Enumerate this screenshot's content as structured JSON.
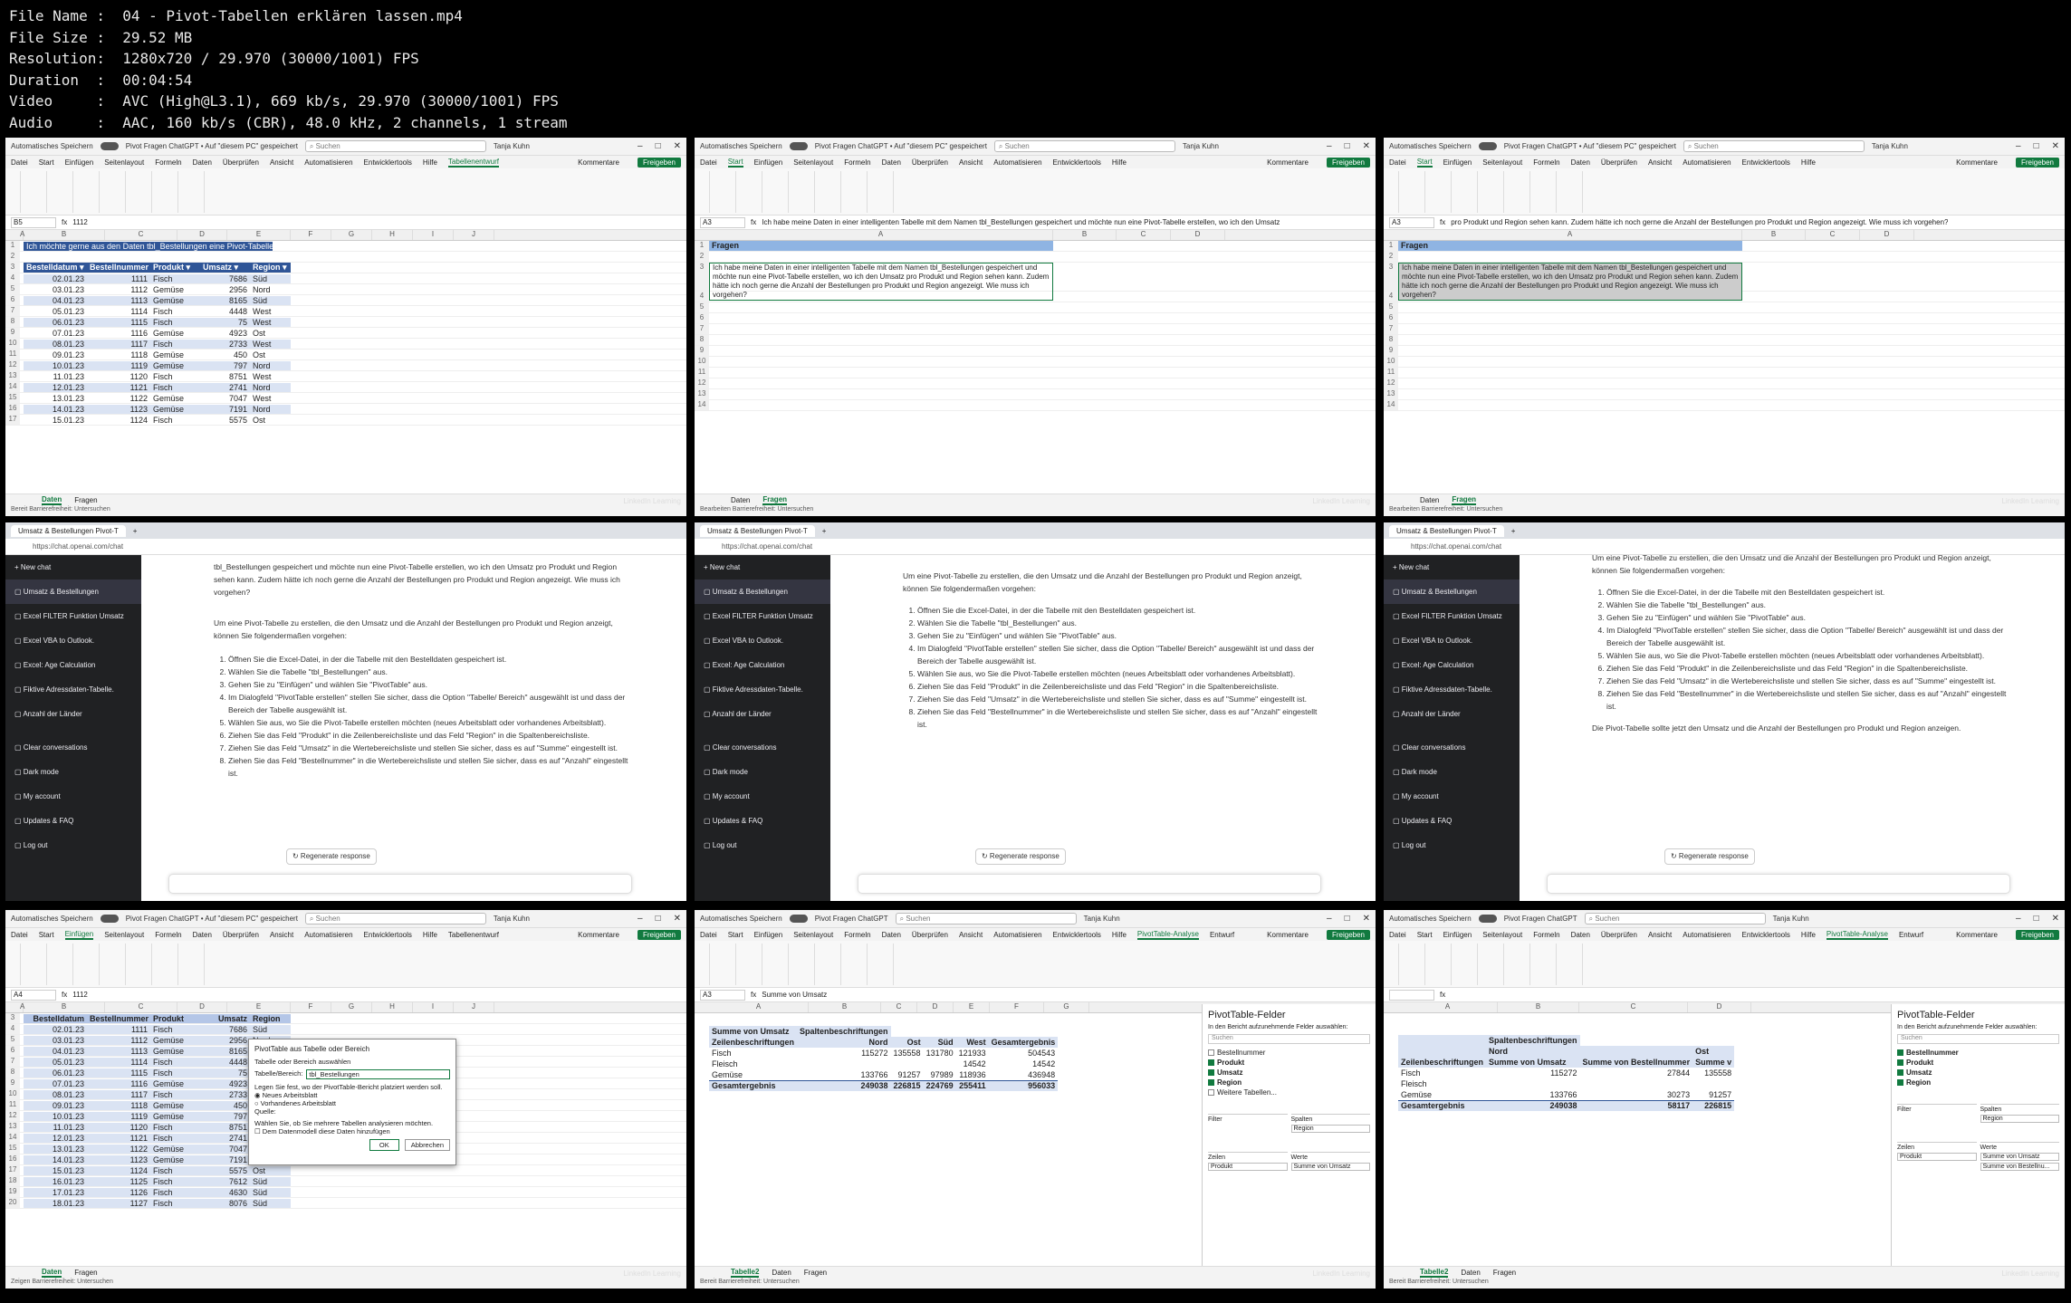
{
  "header": {
    "lines": [
      {
        "k": "File Name ",
        "v": "04 - Pivot-Tabellen erklären lassen.mp4"
      },
      {
        "k": "File Size ",
        "v": "29.52 MB"
      },
      {
        "k": "Resolution",
        "v": "1280x720 / 29.970 (30000/1001) FPS"
      },
      {
        "k": "Duration  ",
        "v": "00:04:54"
      },
      {
        "k": "Video     ",
        "v": "AVC (High@L3.1), 669 kb/s, 29.970 (30000/1001) FPS"
      },
      {
        "k": "Audio     ",
        "v": "AAC, 160 kb/s (CBR), 48.0 kHz, 2 channels, 1 stream"
      }
    ]
  },
  "excel": {
    "autosave": "Automatisches Speichern",
    "search": "Suchen",
    "user": "Tanja Kuhn",
    "comments": "Kommentare",
    "share": "Freigeben",
    "status": "Bereit",
    "access": "Barrierefreiheit: Untersuchen",
    "watermark": "LinkedIn Learning"
  },
  "t1": {
    "title": "Pivot Fragen ChatGPT • Auf \"diesem PC\" gespeichert",
    "tabs": [
      "Datei",
      "Start",
      "Einfügen",
      "Seitenlayout",
      "Formeln",
      "Daten",
      "Überprüfen",
      "Ansicht",
      "Automatisieren",
      "Entwicklertools",
      "Hilfe",
      "Tabellenentwurf"
    ],
    "namebox": "B5",
    "formula": "1112",
    "heading": "Ich möchte gerne aus den Daten tbl_Bestellungen eine Pivot-Tabelle erstellen",
    "cols": [
      "Bestelldatum",
      "Bestellnummer",
      "Produkt",
      "Umsatz",
      "Region"
    ],
    "rows": [
      [
        "02.01.23",
        "1111",
        "Fisch",
        "7686",
        "Süd"
      ],
      [
        "03.01.23",
        "1112",
        "Gemüse",
        "2956",
        "Nord"
      ],
      [
        "04.01.23",
        "1113",
        "Gemüse",
        "8165",
        "Süd"
      ],
      [
        "05.01.23",
        "1114",
        "Fisch",
        "4448",
        "West"
      ],
      [
        "06.01.23",
        "1115",
        "Fisch",
        "75",
        "West"
      ],
      [
        "07.01.23",
        "1116",
        "Gemüse",
        "4923",
        "Ost"
      ],
      [
        "08.01.23",
        "1117",
        "Fisch",
        "2733",
        "West"
      ],
      [
        "09.01.23",
        "1118",
        "Gemüse",
        "450",
        "Ost"
      ],
      [
        "10.01.23",
        "1119",
        "Gemüse",
        "797",
        "Nord"
      ],
      [
        "11.01.23",
        "1120",
        "Fisch",
        "8751",
        "West"
      ],
      [
        "12.01.23",
        "1121",
        "Fisch",
        "2741",
        "Nord"
      ],
      [
        "13.01.23",
        "1122",
        "Gemüse",
        "7047",
        "West"
      ],
      [
        "14.01.23",
        "1123",
        "Gemüse",
        "7191",
        "Nord"
      ],
      [
        "15.01.23",
        "1124",
        "Fisch",
        "5575",
        "Ost"
      ]
    ],
    "sheets": [
      "Daten",
      "Fragen"
    ]
  },
  "t2": {
    "title": "Pivot Fragen ChatGPT • Auf \"diesem PC\" gespeichert",
    "tabs": [
      "Datei",
      "Start",
      "Einfügen",
      "Seitenlayout",
      "Formeln",
      "Daten",
      "Überprüfen",
      "Ansicht",
      "Automatisieren",
      "Entwicklertools",
      "Hilfe"
    ],
    "namebox": "A3",
    "formula": "Ich habe meine Daten in einer intelligenten Tabelle mit dem Namen tbl_Bestellungen gespeichert und möchte nun eine Pivot-Tabelle erstellen, wo ich den Umsatz",
    "heading": "Fragen",
    "question": "Ich habe meine Daten in einer intelligenten Tabelle mit dem Namen tbl_Bestellungen gespeichert und möchte nun eine Pivot-Tabelle erstellen, wo ich den Umsatz pro Produkt und Region sehen kann. Zudem hätte ich noch gerne die Anzahl der Bestellungen pro Produkt und Region angezeigt. Wie muss ich vorgehen?",
    "sheets": [
      "Daten",
      "Fragen"
    ],
    "status": "Bearbeiten"
  },
  "t3": {
    "formula": "pro Produkt und Region sehen kann. Zudem hätte ich noch gerne die Anzahl der Bestellungen pro Produkt und Region angezeigt. Wie muss ich vorgehen?"
  },
  "chat": {
    "tab": "Umsatz & Bestellungen Pivot-T",
    "url": "https://chat.openai.com/chat",
    "side": [
      "New chat",
      "Umsatz & Bestellungen",
      "Excel FILTER Funktion Umsatz",
      "Excel VBA to Outlook.",
      "Excel: Age Calculation",
      "Fiktive Adressdaten-Tabelle.",
      "Anzahl der Länder",
      "Clear conversations",
      "Dark mode",
      "My account",
      "Updates & FAQ",
      "Log out"
    ],
    "user_q": "tbl_Bestellungen gespeichert und möchte nun eine Pivot-Tabelle erstellen, wo ich den Umsatz pro Produkt und Region sehen kann. Zudem hätte ich noch gerne die Anzahl der Bestellungen pro Produkt und Region angezeigt. Wie muss ich vorgehen?",
    "intro": "Um eine Pivot-Tabelle zu erstellen, die den Umsatz und die Anzahl der Bestellungen pro Produkt und Region anzeigt, können Sie folgendermaßen vorgehen:",
    "steps": [
      "Öffnen Sie die Excel-Datei, in der die Tabelle mit den Bestelldaten gespeichert ist.",
      "Wählen Sie die Tabelle \"tbl_Bestellungen\" aus.",
      "Gehen Sie zu \"Einfügen\" und wählen Sie \"PivotTable\" aus.",
      "Im Dialogfeld \"PivotTable erstellen\" stellen Sie sicher, dass die Option \"Tabelle/ Bereich\" ausgewählt ist und dass der Bereich der Tabelle ausgewählt ist.",
      "Wählen Sie aus, wo Sie die Pivot-Tabelle erstellen möchten (neues Arbeitsblatt oder vorhandenes Arbeitsblatt).",
      "Ziehen Sie das Feld \"Produkt\" in die Zeilenbereichsliste und das Feld \"Region\" in die Spaltenbereichsliste.",
      "Ziehen Sie das Feld \"Umsatz\" in die Wertebereichsliste und stellen Sie sicher, dass es auf \"Summe\" eingestellt ist.",
      "Ziehen Sie das Feld \"Bestellnummer\" in die Wertebereichsliste und stellen Sie sicher, dass es auf \"Anzahl\" eingestellt ist."
    ],
    "outro": "Die Pivot-Tabelle sollte jetzt den Umsatz und die Anzahl der Bestellungen pro Produkt und Region anzeigen.",
    "regen": "Regenerate response"
  },
  "t7": {
    "namebox": "A4",
    "formula": "1112",
    "dialog_title": "PivotTable aus Tabelle oder Bereich",
    "dialog_sub": "Tabelle oder Bereich auswählen",
    "dialog_range_label": "Tabelle/Bereich:",
    "dialog_range": "tbl_Bestellungen",
    "dialog_place": "Legen Sie fest, wo der PivotTable-Bericht platziert werden soll.",
    "opt_new": "Neues Arbeitsblatt",
    "opt_existing": "Vorhandenes Arbeitsblatt",
    "source_label": "Quelle:",
    "multi": "Wählen Sie, ob Sie mehrere Tabellen analysieren möchten.",
    "datamodel": "Dem Datenmodell diese Daten hinzufügen",
    "ok": "OK",
    "cancel": "Abbrechen",
    "extra_rows": [
      [
        "16.01.23",
        "1125",
        "Fisch",
        "7612",
        "Süd"
      ],
      [
        "17.01.23",
        "1126",
        "Fisch",
        "4630",
        "Süd"
      ],
      [
        "18.01.23",
        "1127",
        "Fisch",
        "8076",
        "Süd"
      ]
    ],
    "sheets": [
      "Daten",
      "Fragen"
    ],
    "status": "Zeigen"
  },
  "t8": {
    "title": "Pivot Fragen ChatGPT",
    "namebox": "A3",
    "formula": "Summe von Umsatz",
    "pv_title": "Summe von Umsatz",
    "col_labels": "Spaltenbeschriftungen",
    "row_labels": "Zeilenbeschriftungen",
    "regions": [
      "Nord",
      "Ost",
      "Süd",
      "West",
      "Gesamtergebnis"
    ],
    "rows": [
      {
        "label": "Fisch",
        "vals": [
          "115272",
          "135558",
          "131780",
          "121933",
          "504543"
        ]
      },
      {
        "label": "Fleisch",
        "vals": [
          "",
          "",
          "",
          "14542",
          "14542"
        ]
      },
      {
        "label": "Gemüse",
        "vals": [
          "133766",
          "91257",
          "97989",
          "118936",
          "436948"
        ]
      },
      {
        "label": "Gesamtergebnis",
        "vals": [
          "249038",
          "226815",
          "224769",
          "255411",
          "956033"
        ]
      }
    ],
    "pane_title": "PivotTable-Felder",
    "pane_sub": "In den Bericht aufzunehmende Felder auswählen:",
    "fields": [
      {
        "name": "Bestellnummer",
        "on": false
      },
      {
        "name": "Produkt",
        "on": true
      },
      {
        "name": "Umsatz",
        "on": true
      },
      {
        "name": "Region",
        "on": true
      },
      {
        "name": "Weitere Tabellen...",
        "on": false
      }
    ],
    "filter": "Filter",
    "cols_area": "Spalten",
    "rows_area": "Zeilen",
    "vals_area": "Werte",
    "cols_val": "Region",
    "rows_val": "Produkt",
    "vals_val": "Summe von Umsatz",
    "sheets": [
      "Tabelle2",
      "Daten",
      "Fragen"
    ]
  },
  "t9": {
    "title": "Pivot Fragen ChatGPT",
    "col_labels": "Spaltenbeschriftungen",
    "row_labels": "Zeilenbeschriftungen",
    "regions": [
      "Nord",
      "Ost"
    ],
    "sub_sum": "Summe von Umsatz",
    "sub_cnt": "Summe von Bestellnummer",
    "sub_trunc": "Summe v",
    "rows": [
      {
        "label": "Fisch",
        "vals": [
          "115272",
          "27844",
          "135558"
        ]
      },
      {
        "label": "Fleisch",
        "vals": [
          "",
          "",
          ""
        ]
      },
      {
        "label": "Gemüse",
        "vals": [
          "133766",
          "30273",
          "91257"
        ]
      },
      {
        "label": "Gesamtergebnis",
        "vals": [
          "249038",
          "58117",
          "226815"
        ]
      }
    ],
    "fields": [
      {
        "name": "Bestellnummer",
        "on": true
      },
      {
        "name": "Produkt",
        "on": true
      },
      {
        "name": "Umsatz",
        "on": true
      },
      {
        "name": "Region",
        "on": true
      }
    ],
    "vals": [
      "Summe von Umsatz",
      "Summe von Bestellnu..."
    ]
  }
}
